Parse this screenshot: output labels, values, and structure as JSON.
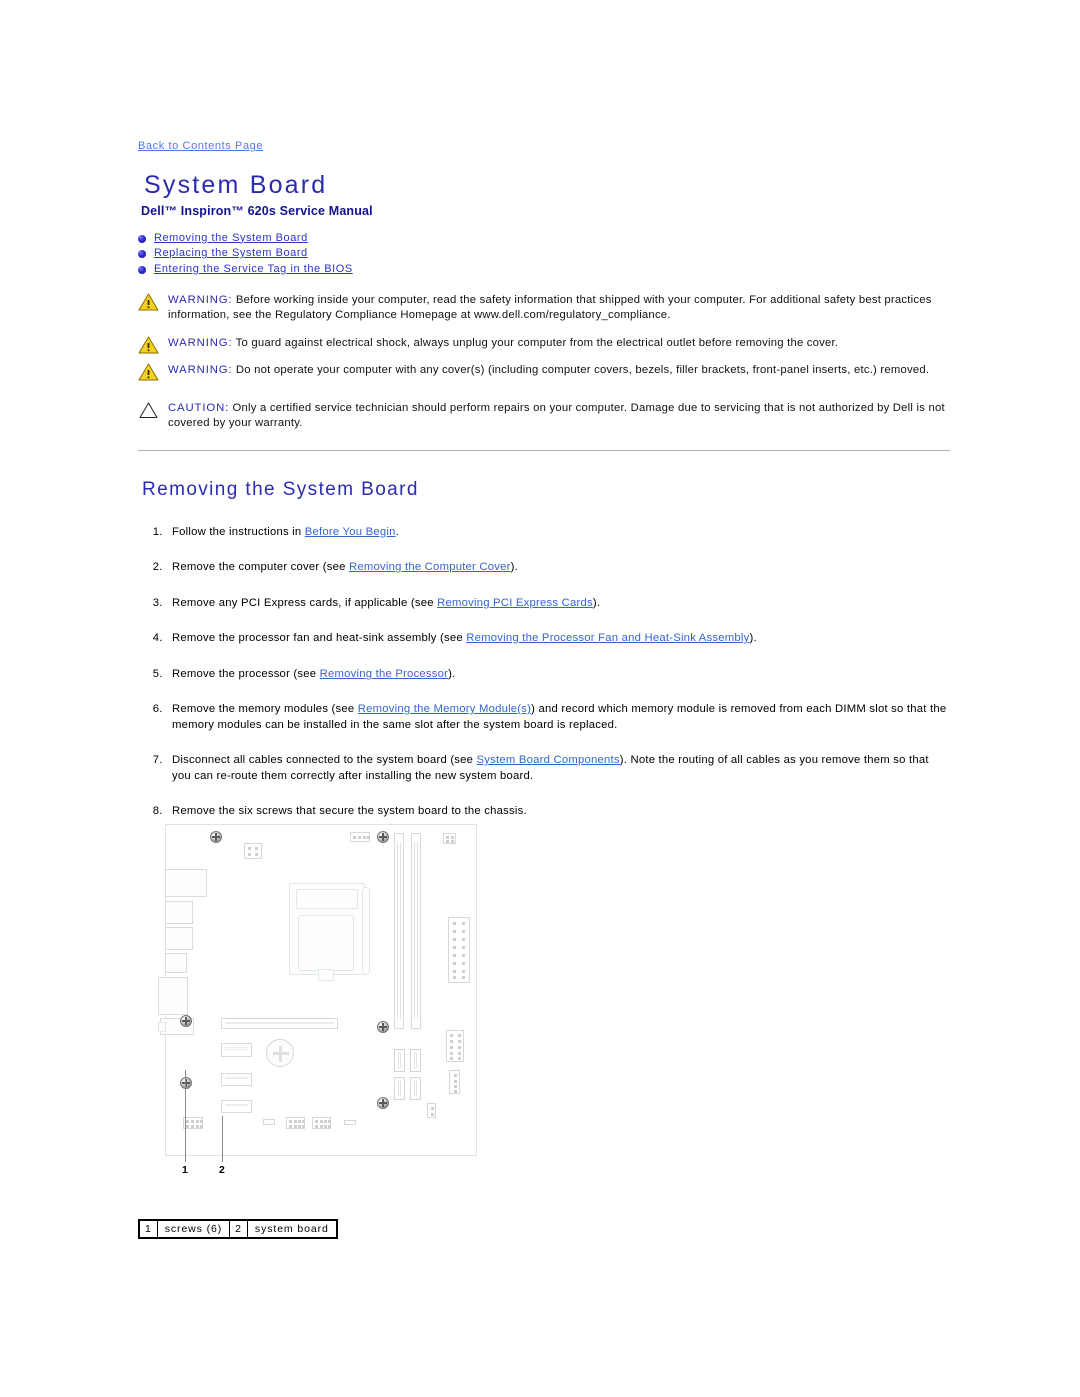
{
  "nav": {
    "back_link": "Back to Contents Page"
  },
  "header": {
    "title": "System Board",
    "subtitle": "Dell™ Inspiron™ 620s Service Manual"
  },
  "toc": [
    {
      "label": "Removing the System Board"
    },
    {
      "label": "Replacing the System Board"
    },
    {
      "label": "Entering the Service Tag in the BIOS"
    }
  ],
  "notices": [
    {
      "icon": "warning-triangle-icon",
      "keyword": "WARNING:",
      "text": " Before working inside your computer, read the safety information that shipped with your computer. For additional safety best practices information, see the Regulatory Compliance Homepage at www.dell.com/regulatory_compliance."
    },
    {
      "icon": "warning-triangle-icon",
      "keyword": "WARNING:",
      "text": " To guard against electrical shock, always unplug your computer from the electrical outlet before removing the cover."
    },
    {
      "icon": "warning-triangle-icon",
      "keyword": "WARNING:",
      "text": " Do not operate your computer with any cover(s) (including computer covers, bezels, filler brackets, front-panel inserts, etc.) removed."
    },
    {
      "icon": "caution-triangle-icon",
      "keyword": "CAUTION:",
      "text": " Only a certified service technician should perform repairs on your computer. Damage due to servicing that is not authorized by Dell is not covered by your warranty."
    }
  ],
  "section": {
    "heading": "Removing the System Board"
  },
  "steps": [
    {
      "pre": "Follow the instructions in ",
      "link": "Before You Begin",
      "post": "."
    },
    {
      "pre": "Remove the computer cover (see ",
      "link": "Removing the Computer Cover",
      "post": ")."
    },
    {
      "pre": "Remove any PCI Express cards, if applicable (see ",
      "link": "Removing PCI Express Cards",
      "post": ")."
    },
    {
      "pre": "Remove the processor fan and heat-sink assembly (see ",
      "link": "Removing the Processor Fan and Heat-Sink Assembly",
      "post": ")."
    },
    {
      "pre": "Remove the processor (see ",
      "link": "Removing the Processor",
      "post": ")."
    },
    {
      "pre": "Remove the memory modules (see ",
      "link": "Removing the Memory Module(s)",
      "post": ") and record which memory module is removed from each DIMM slot so that the memory modules can be installed in the same slot after the system board is replaced."
    },
    {
      "pre": "Disconnect all cables connected to the system board (see ",
      "link": "System Board Components",
      "post": "). Note the routing of all cables as you remove them so that you can re-route them correctly after installing the new system board."
    },
    {
      "pre": "Remove the six screws that secure the system board to the chassis.",
      "link": "",
      "post": ""
    }
  ],
  "figure": {
    "callouts": [
      {
        "number": "1"
      },
      {
        "number": "2"
      }
    ],
    "legend": [
      {
        "number": "1",
        "label": "screws (6)"
      },
      {
        "number": "2",
        "label": "system board"
      }
    ]
  },
  "colors": {
    "heading_blue": "#2b2bb0",
    "link_blue": "#3366cc",
    "toplink_blue": "#4a7ee0",
    "warning_yellow": "#f5d21e",
    "rule_gray": "#b0b0b0"
  }
}
